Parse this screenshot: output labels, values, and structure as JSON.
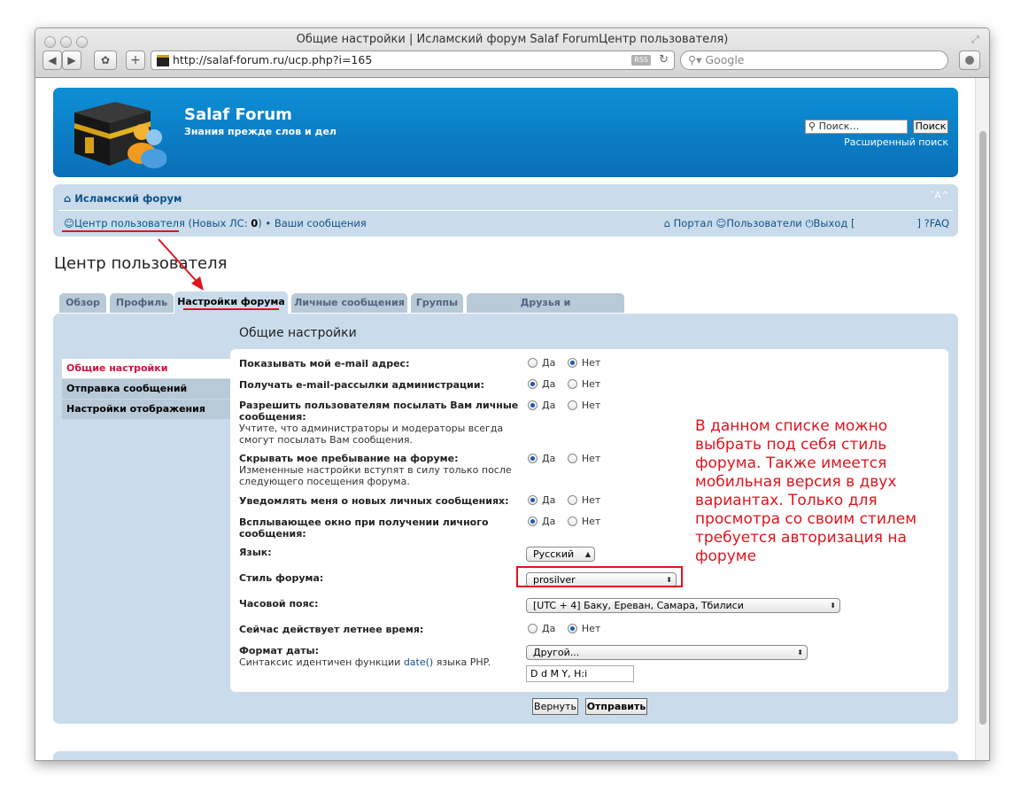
{
  "browser": {
    "window_title": "Общие настройки | Исламский форум Salaf ForumЦентр пользователя)",
    "url": "http://salaf-forum.ru/ucp.php?i=165",
    "rss_label": "RSS",
    "search_placeholder": "Google"
  },
  "header": {
    "site_title": "Salaf Forum",
    "site_description": "Знания прежде слов и дел",
    "search_placeholder": "Поиск…",
    "search_button": "Поиск",
    "advanced_search": "Расширенный поиск"
  },
  "navbar": {
    "home": "Исламский форум",
    "font_size": "ˇA^",
    "ucp_link": "Центр пользователя",
    "new_pm_prefix": "(Новых ЛС: ",
    "new_pm_count": "0",
    "new_pm_suffix": ")",
    "bullet": "•",
    "your_posts": "Ваши сообщения",
    "portal": "Портал",
    "members": "Пользователи",
    "logout": "Выход [",
    "logout_close": "]",
    "faq": "FAQ"
  },
  "page_title": "Центр пользователя",
  "tabs": [
    {
      "label": "Обзор"
    },
    {
      "label": "Профиль"
    },
    {
      "label": "Настройки форума"
    },
    {
      "label": "Личные сообщения"
    },
    {
      "label": "Группы"
    },
    {
      "label": "Друзья и недоброжелатели"
    }
  ],
  "side_menu": [
    {
      "label": "Общие настройки"
    },
    {
      "label": "Отправка сообщений"
    },
    {
      "label": "Настройки отображения"
    }
  ],
  "section_title": "Общие настройки",
  "radio_yes": "Да",
  "radio_no": "Нет",
  "fields": {
    "show_email": {
      "label": "Показывать мой e-mail адрес:"
    },
    "admin_mail": {
      "label": "Получать e-mail-рассылки администрации:"
    },
    "allow_pm": {
      "label_line1": "Разрешить пользователям посылать Вам личные",
      "label_line2": "сообщения:",
      "explain_line1": "Учтите, что администраторы и модераторы всегда",
      "explain_line2": "смогут посылать Вам сообщения."
    },
    "hide_online": {
      "label": "Скрывать мое пребывание на форуме:",
      "explain_line1": "Измененные настройки вступят в силу только после",
      "explain_line2": "следующего посещения форума."
    },
    "notify_pm": {
      "label": "Уведомлять меня о новых личных сообщениях:"
    },
    "popup_pm": {
      "label_line1": "Всплывающее окно при получении личного",
      "label_line2": "сообщения:"
    },
    "language": {
      "label": "Язык:",
      "value": "Русский"
    },
    "style": {
      "label": "Стиль форума:",
      "value": "prosilver"
    },
    "timezone": {
      "label": "Часовой пояс:",
      "value": "[UTC + 4] Баку, Ереван, Самара, Тбилиси"
    },
    "dst": {
      "label": "Сейчас действует летнее время:"
    },
    "date_format": {
      "label": "Формат даты:",
      "explain_prefix": "Синтаксис идентичен функции ",
      "explain_link": "date()",
      "explain_suffix": " языка PHP.",
      "select_value": "Другой...",
      "input_value": "D d M Y, H:i"
    }
  },
  "buttons": {
    "reset": "Вернуть",
    "submit": "Отправить"
  },
  "annotation": {
    "line1": "В данном списке можно",
    "line2": "выбрать под себя стиль",
    "line3": "форума. Также имеется",
    "line4": "мобильная версия в двух",
    "line5": "вариантах. Только для",
    "line6": "просмотра со своим стилем",
    "line7": "требуется авторизация на",
    "line8": "форуме"
  },
  "colors": {
    "header_blue": "#0a6fb8",
    "panel_bg": "#cadceb",
    "active_menu_text": "#d31141",
    "annotation_red": "#e0141e"
  }
}
